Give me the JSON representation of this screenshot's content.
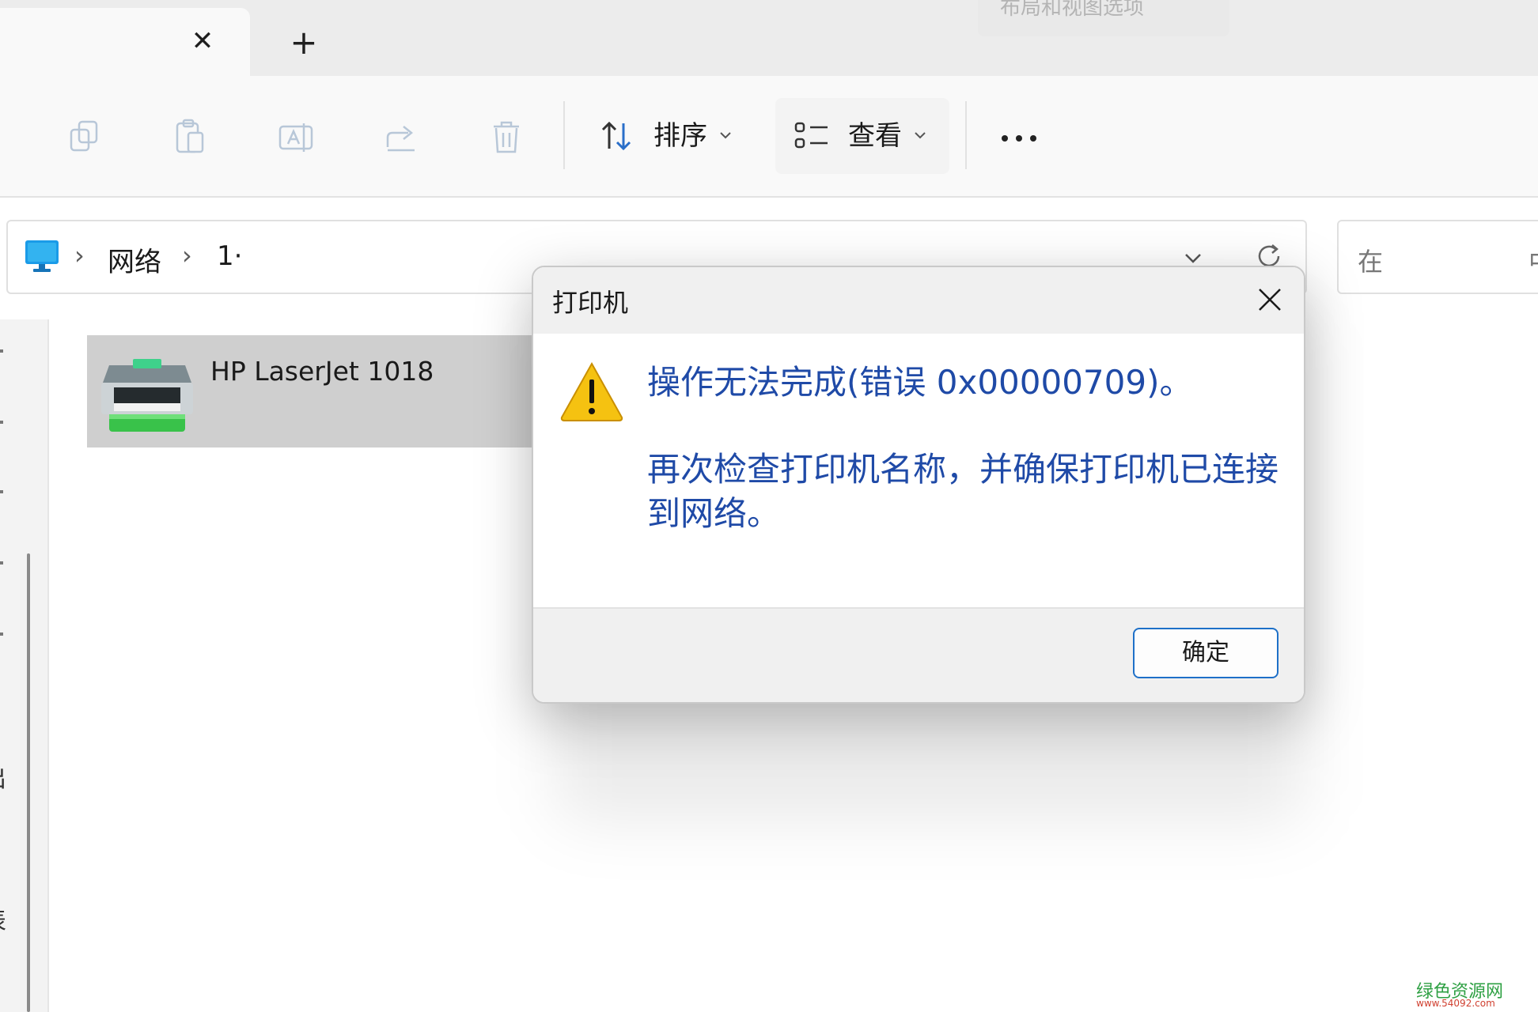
{
  "tabs": {
    "close_glyph": "✕",
    "new_tab_glyph": "+"
  },
  "toolbar": {
    "layout_hint": "布局和视图选项",
    "sort_label": "排序",
    "view_label": "查看",
    "more_glyph": "•••"
  },
  "address": {
    "crumbs": [
      "网络",
      "1·"
    ],
    "sep": "›"
  },
  "search": {
    "placeholder": "在",
    "trailing": "中"
  },
  "nav_pane": {
    "label_a": "出",
    "label_b": "表"
  },
  "printer": {
    "name": "HP LaserJet 1018"
  },
  "dialog": {
    "title": "打印机",
    "message1": "操作无法完成(错误 0x00000709)。",
    "message2": "再次检查打印机名称，并确保打印机已连接到网络。",
    "ok_label": "确定"
  },
  "watermark": {
    "text": "绿色资源网",
    "url": "www.54092.com"
  },
  "colors": {
    "message": "#1f4aa7",
    "accent": "#1e70c8",
    "warning": "#f5c211"
  }
}
